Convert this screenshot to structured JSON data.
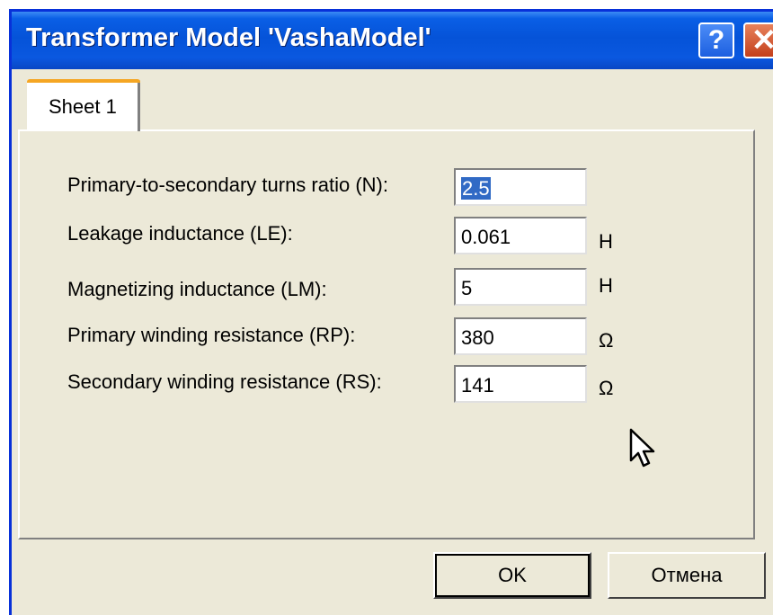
{
  "window": {
    "title": "Transformer Model 'VashaModel'",
    "help_glyph": "?",
    "close_glyph": "✕"
  },
  "tabs": [
    {
      "label": "Sheet 1",
      "active": true
    }
  ],
  "fields": [
    {
      "label": "Primary-to-secondary turns ratio (N):",
      "value": "2.5",
      "unit": ""
    },
    {
      "label": "Leakage inductance (LE):",
      "value": "0.061",
      "unit": "H"
    },
    {
      "label": "Magnetizing inductance (LM):",
      "value": "5",
      "unit": "H"
    },
    {
      "label": "Primary winding resistance (RP):",
      "value": "380",
      "unit": "Ω"
    },
    {
      "label": "Secondary winding resistance (RS):",
      "value": "141",
      "unit": "Ω"
    }
  ],
  "buttons": {
    "ok_label": "OK",
    "cancel_label": "Отмена"
  },
  "colors": {
    "titlebar": "#0553d8",
    "dialog_bg": "#ece9d8",
    "selection": "#316ac5"
  },
  "icons": [
    "help-icon",
    "close-icon",
    "mouse-pointer-icon"
  ]
}
